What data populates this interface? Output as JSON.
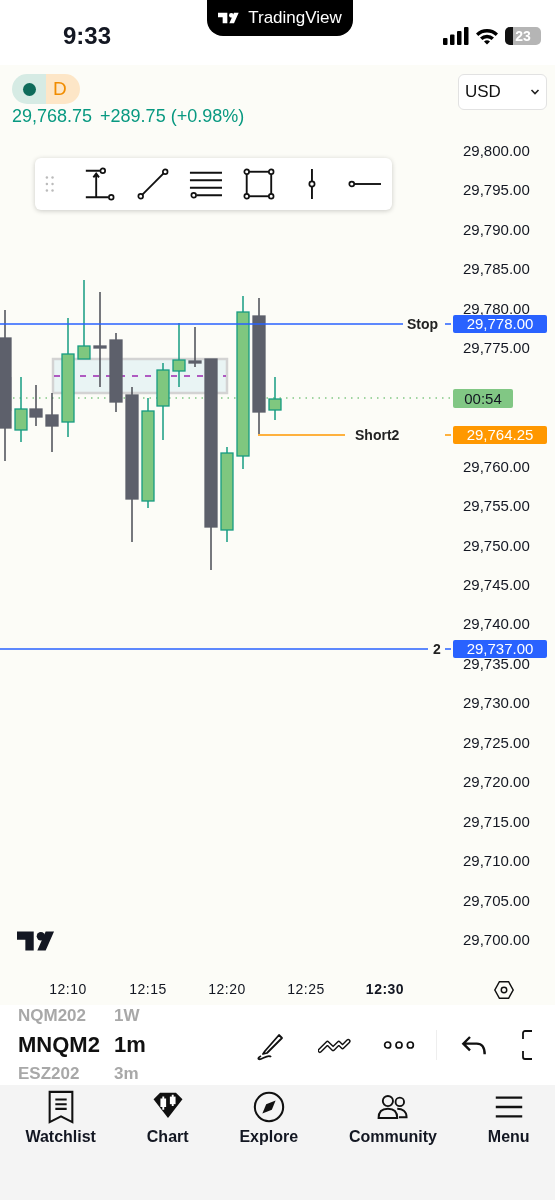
{
  "status_bar": {
    "time": "9:33",
    "battery": "23"
  },
  "banner": {
    "brand": "TradingView"
  },
  "header": {
    "session": "D",
    "price": "29,768.75",
    "change": "+289.75 (+0.98%)",
    "currency": "USD"
  },
  "price_axis": {
    "labels": [
      {
        "text": "29,800.00"
      },
      {
        "text": "29,795.00"
      },
      {
        "text": "29,790.00"
      },
      {
        "text": "29,785.00"
      },
      {
        "text": "29,780.00"
      },
      {
        "text": "29,775.00"
      },
      {
        "text": "29,760.00"
      },
      {
        "text": "29,755.00"
      },
      {
        "text": "29,750.00"
      },
      {
        "text": "29,745.00"
      },
      {
        "text": "29,740.00"
      },
      {
        "text": "29,735.00"
      },
      {
        "text": "29,730.00"
      },
      {
        "text": "29,725.00"
      },
      {
        "text": "29,720.00"
      },
      {
        "text": "29,715.00"
      },
      {
        "text": "29,710.00"
      },
      {
        "text": "29,705.00"
      },
      {
        "text": "29,700.00"
      }
    ]
  },
  "price_lines": [
    {
      "label": "Stop",
      "price": "29,778.00",
      "color": "#2962ff"
    },
    {
      "label": "Short2",
      "price": "29,764.25",
      "color": "#ff9800"
    },
    {
      "label": "2",
      "price": "29,737.00",
      "color": "#2962ff"
    }
  ],
  "countdown": "00:54",
  "time_axis": [
    {
      "text": "12:10",
      "bold": false
    },
    {
      "text": "12:15",
      "bold": false
    },
    {
      "text": "12:20",
      "bold": false
    },
    {
      "text": "12:25",
      "bold": false
    },
    {
      "text": "12:30",
      "bold": true
    }
  ],
  "symbol_picker": [
    {
      "text": "NQM202",
      "selected": false
    },
    {
      "text": "MNQM2",
      "selected": true
    },
    {
      "text": "ESZ202",
      "selected": false
    }
  ],
  "interval_picker": [
    {
      "text": "1W",
      "selected": false
    },
    {
      "text": "1m",
      "selected": true
    },
    {
      "text": "3m",
      "selected": false
    }
  ],
  "nav": [
    {
      "label": "Watchlist",
      "selected": false
    },
    {
      "label": "Chart",
      "selected": true
    },
    {
      "label": "Explore",
      "selected": false
    },
    {
      "label": "Community",
      "selected": false
    },
    {
      "label": "Menu",
      "selected": false
    }
  ]
}
